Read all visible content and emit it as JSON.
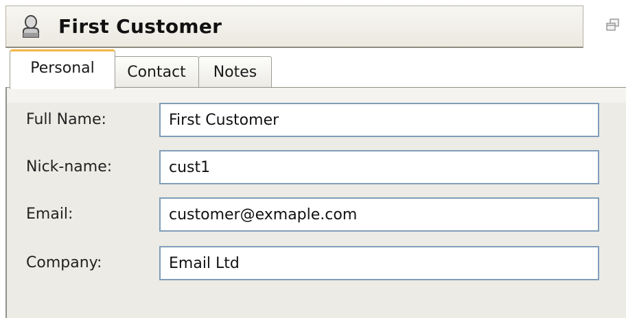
{
  "window": {
    "title": "First Customer",
    "title_icon": "user-icon",
    "restore_icon": "window-restore-icon"
  },
  "tabs": [
    {
      "label": "Personal",
      "active": true
    },
    {
      "label": "Contact",
      "active": false
    },
    {
      "label": "Notes",
      "active": false
    }
  ],
  "form": {
    "fields": [
      {
        "label": "Full Name:",
        "value": "First Customer"
      },
      {
        "label": "Nick-name:",
        "value": "cust1"
      },
      {
        "label": "Email:",
        "value": "customer@exmaple.com"
      },
      {
        "label": "Company:",
        "value": "Email Ltd"
      }
    ]
  },
  "colors": {
    "active_tab_accent": "#f1b543",
    "input_border": "#7f9db9",
    "panel_background": "#edebe5"
  }
}
